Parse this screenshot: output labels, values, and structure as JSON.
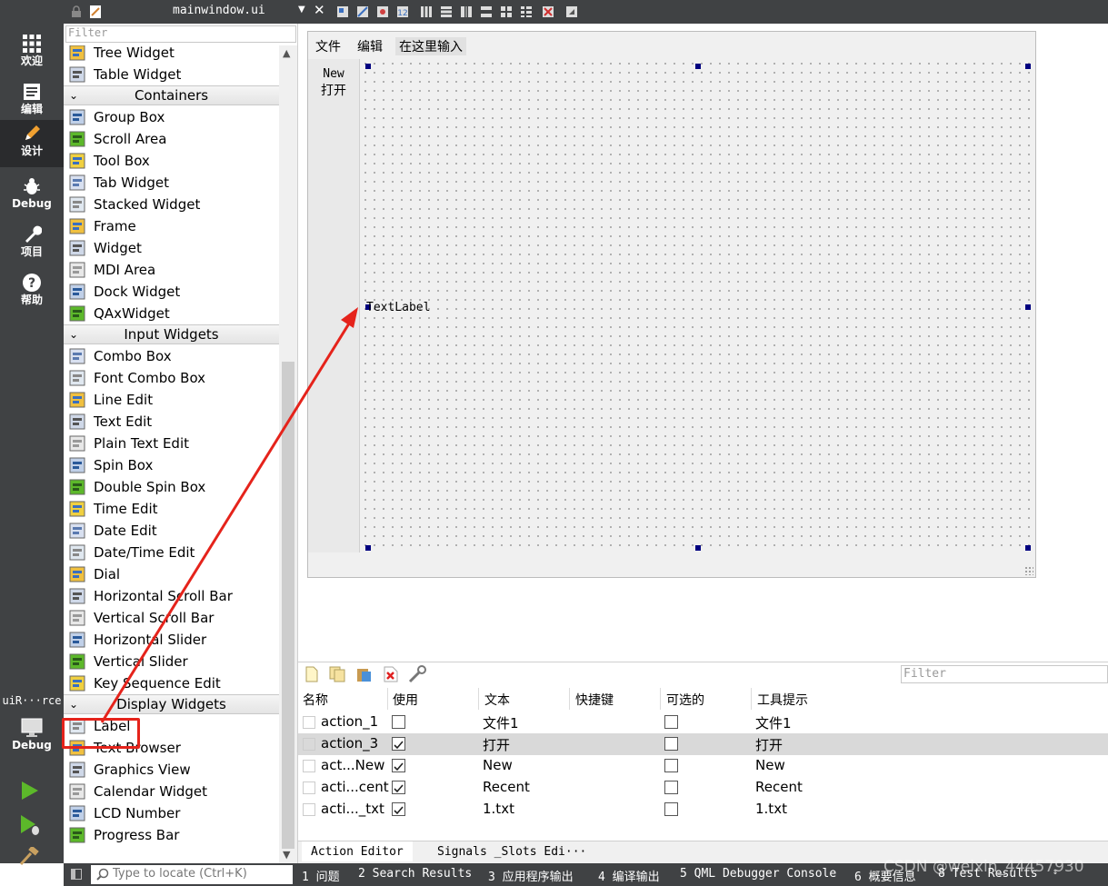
{
  "modes": [
    {
      "label": "欢迎",
      "icon": "grid-icon"
    },
    {
      "label": "编辑",
      "icon": "document-icon"
    },
    {
      "label": "设计",
      "icon": "pencil-icon"
    },
    {
      "label": "Debug",
      "icon": "bug-icon"
    },
    {
      "label": "项目",
      "icon": "wrench-icon"
    },
    {
      "label": "帮助",
      "icon": "help-icon"
    }
  ],
  "kit": {
    "name": "uiR···rce",
    "mode": "Debug"
  },
  "toolbar": {
    "file_title": "mainwindow.ui"
  },
  "widgetbox": {
    "filter_placeholder": "Filter",
    "items": [
      {
        "type": "item",
        "label": "Tree Widget"
      },
      {
        "type": "item",
        "label": "Table Widget"
      },
      {
        "type": "cat",
        "label": "Containers"
      },
      {
        "type": "item",
        "label": "Group Box"
      },
      {
        "type": "item",
        "label": "Scroll Area"
      },
      {
        "type": "item",
        "label": "Tool Box"
      },
      {
        "type": "item",
        "label": "Tab Widget"
      },
      {
        "type": "item",
        "label": "Stacked Widget"
      },
      {
        "type": "item",
        "label": "Frame"
      },
      {
        "type": "item",
        "label": "Widget"
      },
      {
        "type": "item",
        "label": "MDI Area"
      },
      {
        "type": "item",
        "label": "Dock Widget"
      },
      {
        "type": "item",
        "label": "QAxWidget"
      },
      {
        "type": "cat",
        "label": "Input Widgets"
      },
      {
        "type": "item",
        "label": "Combo Box"
      },
      {
        "type": "item",
        "label": "Font Combo Box"
      },
      {
        "type": "item",
        "label": "Line Edit"
      },
      {
        "type": "item",
        "label": "Text Edit"
      },
      {
        "type": "item",
        "label": "Plain Text Edit"
      },
      {
        "type": "item",
        "label": "Spin Box"
      },
      {
        "type": "item",
        "label": "Double Spin Box"
      },
      {
        "type": "item",
        "label": "Time Edit"
      },
      {
        "type": "item",
        "label": "Date Edit"
      },
      {
        "type": "item",
        "label": "Date/Time Edit"
      },
      {
        "type": "item",
        "label": "Dial"
      },
      {
        "type": "item",
        "label": "Horizontal Scroll Bar"
      },
      {
        "type": "item",
        "label": "Vertical Scroll Bar"
      },
      {
        "type": "item",
        "label": "Horizontal Slider"
      },
      {
        "type": "item",
        "label": "Vertical Slider"
      },
      {
        "type": "item",
        "label": "Key Sequence Edit"
      },
      {
        "type": "cat",
        "label": "Display Widgets"
      },
      {
        "type": "item",
        "label": "Label"
      },
      {
        "type": "item",
        "label": "Text Browser"
      },
      {
        "type": "item",
        "label": "Graphics View"
      },
      {
        "type": "item",
        "label": "Calendar Widget"
      },
      {
        "type": "item",
        "label": "LCD Number"
      },
      {
        "type": "item",
        "label": "Progress Bar"
      }
    ]
  },
  "form": {
    "menus": [
      "文件",
      "编辑",
      "在这里输入"
    ],
    "toolbar_button": {
      "line1": "New",
      "line2": "打开"
    },
    "label_text": "TextLabel"
  },
  "actions": {
    "filter_placeholder": "Filter",
    "columns": [
      "名称",
      "使用",
      "文本",
      "快捷键",
      "可选的",
      "工具提示"
    ],
    "rows": [
      {
        "name": "action_1",
        "used": false,
        "text": "文件1",
        "shortcut": "",
        "checkable": false,
        "tooltip": "文件1",
        "selected": false
      },
      {
        "name": "action_3",
        "used": true,
        "text": "打开",
        "shortcut": "",
        "checkable": false,
        "tooltip": "打开",
        "selected": true
      },
      {
        "name": "act...New",
        "used": true,
        "text": "New",
        "shortcut": "",
        "checkable": false,
        "tooltip": "New",
        "selected": false
      },
      {
        "name": "acti...cent",
        "used": true,
        "text": "Recent",
        "shortcut": "",
        "checkable": false,
        "tooltip": "Recent",
        "selected": false
      },
      {
        "name": "acti..._txt",
        "used": true,
        "text": "1.txt",
        "shortcut": "",
        "checkable": false,
        "tooltip": "1.txt",
        "selected": false
      }
    ],
    "tabs": [
      "Action Editor",
      "Signals _Slots Edi···"
    ]
  },
  "statusbar": {
    "locate_placeholder": "Type to locate (Ctrl+K)",
    "panes": [
      "1 问题",
      "2 Search Results",
      "3 应用程序输出",
      "4 编译输出",
      "5 QML Debugger Console",
      "6 概要信息",
      "8 Test Results"
    ]
  },
  "watermark": "CSDN @weixin_44457930",
  "colors": {
    "sidebar": "#404244",
    "handle": "#000080",
    "annotation": "#e5231b"
  }
}
